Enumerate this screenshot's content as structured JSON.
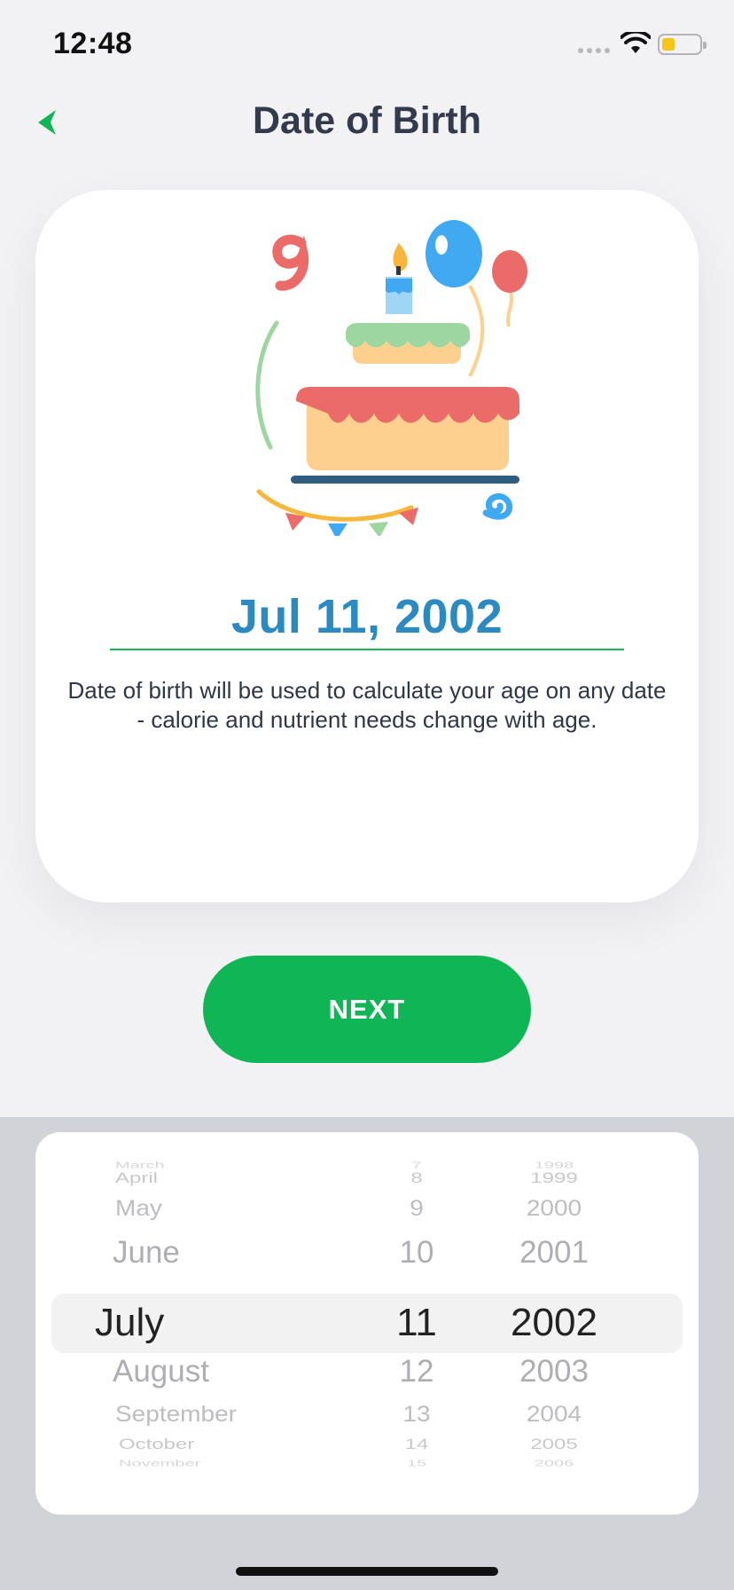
{
  "status_bar": {
    "time": "12:48"
  },
  "nav": {
    "title": "Date of Birth"
  },
  "card": {
    "date_value": "Jul 11, 2002",
    "description": "Date of birth will be used to calculate your age on any date - calorie and nutrient needs change with age."
  },
  "next_button": {
    "label": "NEXT"
  },
  "picker": {
    "months": [
      "March",
      "April",
      "May",
      "June",
      "July",
      "August",
      "September",
      "October",
      "November"
    ],
    "days": [
      "7",
      "8",
      "9",
      "10",
      "11",
      "12",
      "13",
      "14",
      "15"
    ],
    "years": [
      "1998",
      "1999",
      "2000",
      "2001",
      "2002",
      "2003",
      "2004",
      "2005",
      "2006"
    ],
    "selected": {
      "month": "July",
      "day": "11",
      "year": "2002"
    }
  },
  "colors": {
    "accent_green": "#10b655",
    "date_blue": "#2b8ac2",
    "title_dark": "#323a4c"
  },
  "icons": {
    "back": "chevron-left-icon",
    "wifi": "wifi-icon",
    "battery": "battery-icon",
    "signal": "signal-icon",
    "illustration": "birthday-cake-icon"
  }
}
